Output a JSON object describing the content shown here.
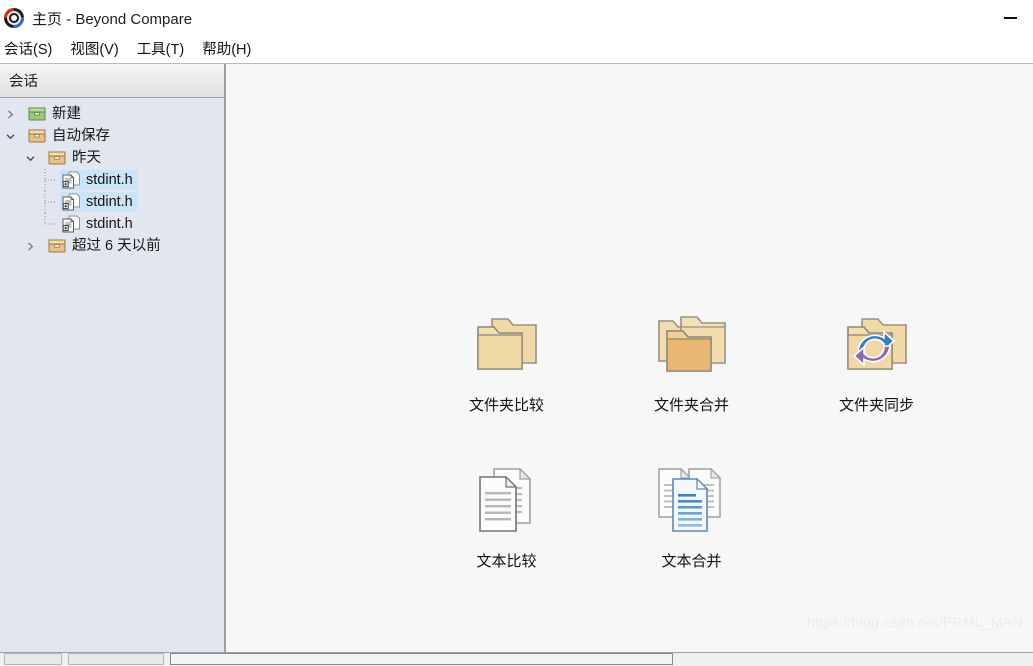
{
  "window": {
    "title": "主页 - Beyond Compare",
    "app_icon": "beyond-compare-logo",
    "minimize_label": "—"
  },
  "menubar": {
    "items": [
      {
        "label": "会话(S)"
      },
      {
        "label": "视图(V)"
      },
      {
        "label": "工具(T)"
      },
      {
        "label": "帮助(H)"
      }
    ]
  },
  "sidebar": {
    "header": "会话",
    "tree": [
      {
        "label": "新建",
        "icon": "green-box-icon",
        "twisty": "chevron-right",
        "level": 0,
        "selected": false
      },
      {
        "label": "自动保存",
        "icon": "tan-box-icon",
        "twisty": "chevron-down",
        "level": 0,
        "selected": false
      },
      {
        "label": "昨天",
        "icon": "tan-box-icon",
        "twisty": "chevron-down",
        "level": 1,
        "selected": false
      },
      {
        "label": "stdint.h",
        "icon": "text-compare-file-icon",
        "twisty": "none",
        "level": 2,
        "selected": true
      },
      {
        "label": "stdint.h",
        "icon": "text-compare-file-icon",
        "twisty": "none",
        "level": 2,
        "selected": true
      },
      {
        "label": "stdint.h",
        "icon": "text-compare-file-icon",
        "twisty": "none",
        "level": 2,
        "selected": false
      },
      {
        "label": "超过 6 天以前",
        "icon": "tan-box-icon",
        "twisty": "chevron-right",
        "level": 1,
        "selected": false
      }
    ]
  },
  "main": {
    "launchers": [
      {
        "label": "文件夹比较",
        "icon": "folder-compare-icon"
      },
      {
        "label": "文件夹合并",
        "icon": "folder-merge-icon"
      },
      {
        "label": "文件夹同步",
        "icon": "folder-sync-icon"
      },
      {
        "label": "文本比较",
        "icon": "text-compare-icon"
      },
      {
        "label": "文本合并",
        "icon": "text-merge-icon"
      }
    ],
    "watermark": "https://blog.csdn.net/PRML_MAN"
  },
  "colors": {
    "sidebar_bg": "#e1e6ef",
    "main_bg": "#f7f7f7",
    "selection": "#cce4f7",
    "folder_light": "#f2dcab",
    "folder_dark": "#e8b872",
    "sync_blue": "#3a7cc0",
    "sync_purple": "#8a6fb0",
    "watermark": "#ebebeb"
  }
}
